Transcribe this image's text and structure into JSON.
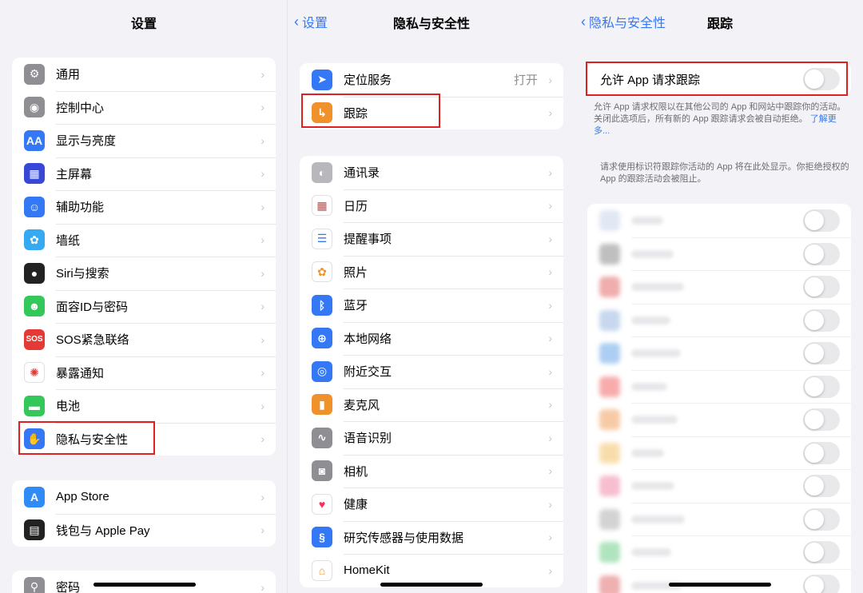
{
  "panel1": {
    "title": "设置",
    "group1": [
      {
        "label": "通用",
        "icon": "gear-icon",
        "color": "#8e8e93"
      },
      {
        "label": "控制中心",
        "icon": "switches-icon",
        "color": "#8e8e93"
      },
      {
        "label": "显示与亮度",
        "icon": "aa-icon",
        "color": "#3478f6",
        "glyph": "AA"
      },
      {
        "label": "主屏幕",
        "icon": "home-grid-icon",
        "color": "#3848d6"
      },
      {
        "label": "辅助功能",
        "icon": "accessibility-icon",
        "color": "#3478f6"
      },
      {
        "label": "墙纸",
        "icon": "flower-icon",
        "color": "#35a9f2"
      },
      {
        "label": "Siri与搜索",
        "icon": "siri-icon",
        "color": "#222"
      },
      {
        "label": "面容ID与密码",
        "icon": "face-id-icon",
        "color": "#34c759"
      },
      {
        "label": "SOS紧急联络",
        "icon": "sos-icon",
        "color": "#e53935",
        "glyph": "SOS"
      },
      {
        "label": "暴露通知",
        "icon": "exposure-icon",
        "color": "#ffffff"
      },
      {
        "label": "电池",
        "icon": "battery-icon",
        "color": "#34c759"
      },
      {
        "label": "隐私与安全性",
        "icon": "hand-icon",
        "color": "#3478f6"
      }
    ],
    "group2": [
      {
        "label": "App Store",
        "icon": "app-store-icon",
        "color": "#2f8bf6"
      },
      {
        "label": "钱包与 Apple Pay",
        "icon": "wallet-icon",
        "color": "#222"
      }
    ],
    "group3": [
      {
        "label": "密码",
        "icon": "key-icon",
        "color": "#8e8e93"
      }
    ]
  },
  "panel2": {
    "back": "设置",
    "title": "隐私与安全性",
    "group1": [
      {
        "label": "定位服务",
        "icon": "location-arrow-icon",
        "color": "#3478f6",
        "value": "打开"
      },
      {
        "label": "跟踪",
        "icon": "tracking-icon",
        "color": "#f0922b"
      }
    ],
    "group2": [
      {
        "label": "通讯录",
        "icon": "contacts-icon",
        "color": "#b8b8bc"
      },
      {
        "label": "日历",
        "icon": "calendar-icon",
        "color": "#ffffff"
      },
      {
        "label": "提醒事项",
        "icon": "reminders-icon",
        "color": "#ffffff"
      },
      {
        "label": "照片",
        "icon": "photos-icon",
        "color": "#ffffff"
      },
      {
        "label": "蓝牙",
        "icon": "bluetooth-icon",
        "color": "#3478f6"
      },
      {
        "label": "本地网络",
        "icon": "globe-icon",
        "color": "#3478f6"
      },
      {
        "label": "附近交互",
        "icon": "nearby-icon",
        "color": "#3478f6"
      },
      {
        "label": "麦克风",
        "icon": "microphone-icon",
        "color": "#f0922b"
      },
      {
        "label": "语音识别",
        "icon": "waveform-icon",
        "color": "#8e8e93"
      },
      {
        "label": "相机",
        "icon": "camera-icon",
        "color": "#8e8e93"
      },
      {
        "label": "健康",
        "icon": "heart-icon",
        "color": "#ffffff"
      },
      {
        "label": "研究传感器与使用数据",
        "icon": "research-icon",
        "color": "#3478f6"
      },
      {
        "label": "HomeKit",
        "icon": "homekit-icon",
        "color": "#ffffff"
      }
    ]
  },
  "panel3": {
    "back": "隐私与安全性",
    "title": "跟踪",
    "allow_label": "允许 App 请求跟踪",
    "note1": "允许 App 请求权限以在其他公司的 App 和网站中跟踪你的活动。关闭此选项后，所有新的 App 跟踪请求会被自动拒绝。",
    "learn_more": "了解更多...",
    "note2": "请求使用标识符跟踪你活动的 App 将在此处显示。你拒绝授权的 App 的跟踪活动会被阻止。",
    "blurred_apps": [
      {
        "color": "#c9d4ea"
      },
      {
        "color": "#8c8c8c"
      },
      {
        "color": "#e36b6b"
      },
      {
        "color": "#9ab7e0"
      },
      {
        "color": "#6aa7e8"
      },
      {
        "color": "#f26a6a"
      },
      {
        "color": "#f0a060"
      },
      {
        "color": "#f4c36a"
      },
      {
        "color": "#f08aa8"
      },
      {
        "color": "#b0b0b0"
      },
      {
        "color": "#6fcf8a"
      },
      {
        "color": "#e27070"
      }
    ]
  }
}
